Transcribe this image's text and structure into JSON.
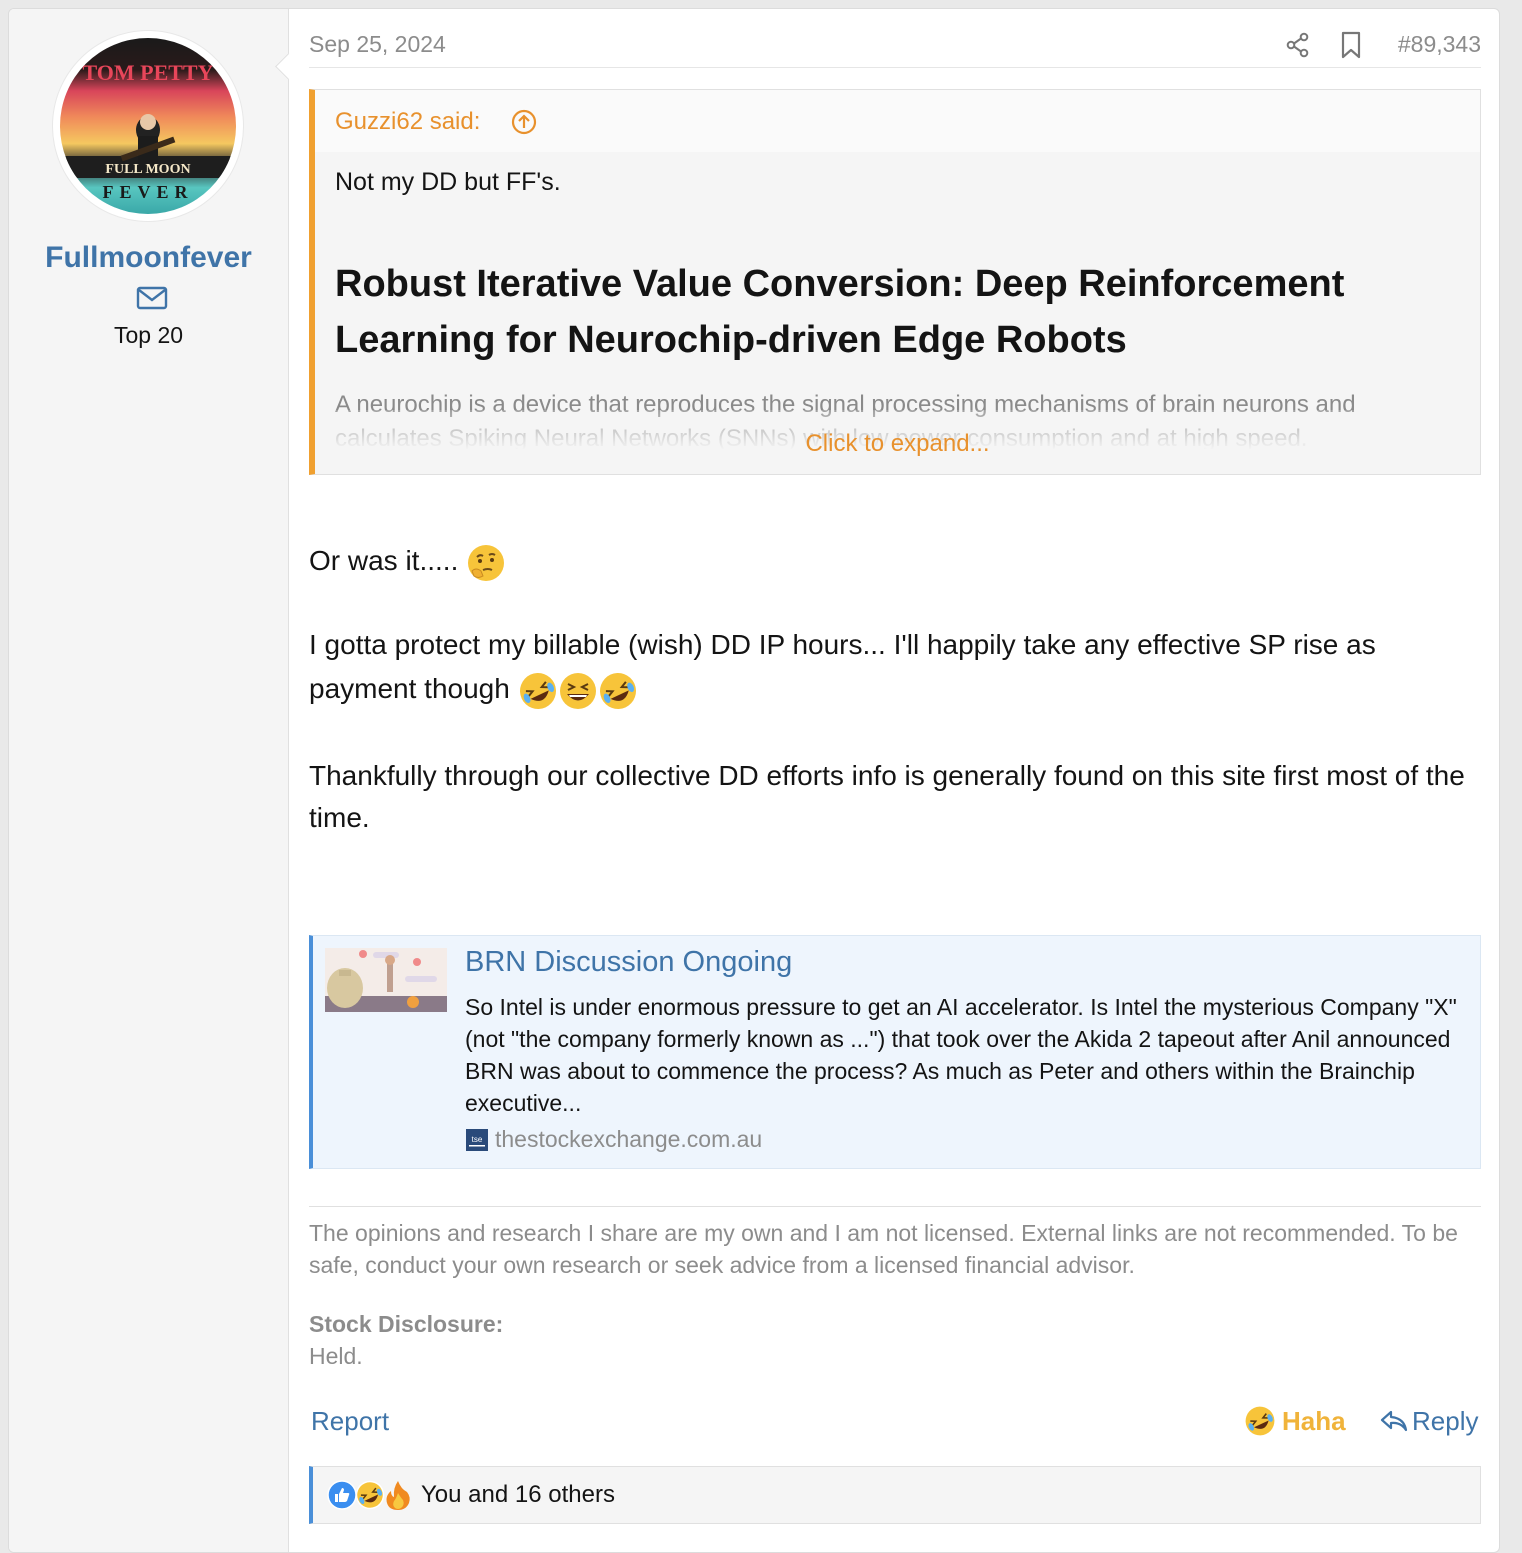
{
  "user": {
    "username": "Fullmoonfever",
    "title": "Top 20",
    "avatar_text": {
      "top": "TOM PETTY",
      "middle": "FULL MOON",
      "bottom": "FEVER"
    }
  },
  "post": {
    "date": "Sep 25, 2024",
    "number": "#89,343",
    "quote": {
      "author": "Guzzi62 said:",
      "text": "Not my DD but FF's.",
      "title": "Robust Iterative Value Conversion: Deep Reinforcement Learning for Neurochip-driven Edge Robots",
      "abstract": "A neurochip is a device that reproduces the signal processing mechanisms of brain neurons and calculates Spiking Neural Networks (SNNs) with low power consumption and at high speed.",
      "expand": "Click to expand..."
    },
    "body": {
      "p1": "Or was it.....",
      "p2": "I gotta protect my billable (wish) DD IP hours... I'll happily take any effective SP rise as payment though",
      "p3": "Thankfully through our collective DD efforts info is generally found on this site first most of the time."
    },
    "unfurl": {
      "title": "BRN Discussion Ongoing",
      "description": "So Intel is under enormous pressure to get an AI accelerator. Is Intel the mysterious Company \"X\" (not \"the company formerly known as ...\") that took over the Akida 2 tapeout after Anil announced BRN was about to commence the process? As much as Peter and others within the Brainchip executive...",
      "domain": "thestockexchange.com.au",
      "favicon_text": "tse"
    },
    "signature": "The opinions and research I share are my own and I am not licensed. External links are not recommended. To be safe, conduct your own research or seek advice from a licensed financial advisor.",
    "disclosure": {
      "label": "Stock Disclosure:",
      "value": "Held."
    },
    "actions": {
      "report": "Report",
      "haha": "Haha",
      "reply": "Reply"
    },
    "reactions": {
      "text": "You and 16 others",
      "icons": [
        "like-icon",
        "haha-icon",
        "fire-icon"
      ]
    }
  },
  "colors": {
    "link": "#3f74a8",
    "quote_accent": "#e8912d",
    "unfurl_accent": "#4a8fd8",
    "haha": "#f0b33a",
    "muted": "#8c8c8c"
  }
}
